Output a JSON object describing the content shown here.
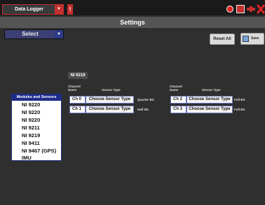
{
  "topbar": {
    "app_name": "Data Logger",
    "alert": "!"
  },
  "header": {
    "title": "Settings"
  },
  "select": {
    "label": "Select"
  },
  "buttons": {
    "reset": "Reset All",
    "save": "Save"
  },
  "module": {
    "name": "NI 9219",
    "col_channel": "Channel",
    "col_name": "Name",
    "col_sensor": "Sensor Type",
    "channels": [
      {
        "ch": "Ch 0",
        "sensor": "Choose Sensor Type",
        "bridge": "Quarter BS"
      },
      {
        "ch": "Ch 1",
        "sensor": "Choose Sensor Type",
        "bridge": "Half BS"
      },
      {
        "ch": "Ch 2",
        "sensor": "Choose Sensor Type",
        "bridge": "Full BS"
      },
      {
        "ch": "Ch 3",
        "sensor": "Choose Sensor Type",
        "bridge": "Full BS"
      }
    ]
  },
  "modules_panel": {
    "header": "Modules and Sensors",
    "items": [
      "NI 9220",
      "NI 9220",
      "NI 9220",
      "NI 9211",
      "NI 9219",
      "NI 9411",
      "NI 9467 (GPS)",
      "IMU"
    ]
  },
  "icons": [
    "alert-icon",
    "record-icon",
    "refresh-icon",
    "link-icon",
    "close-icon",
    "caret-down-icon",
    "save-icon"
  ],
  "colors": {
    "accent_red": "#c43030",
    "select_blue": "#3b3f73",
    "panel_blue": "#1e2c8a"
  }
}
